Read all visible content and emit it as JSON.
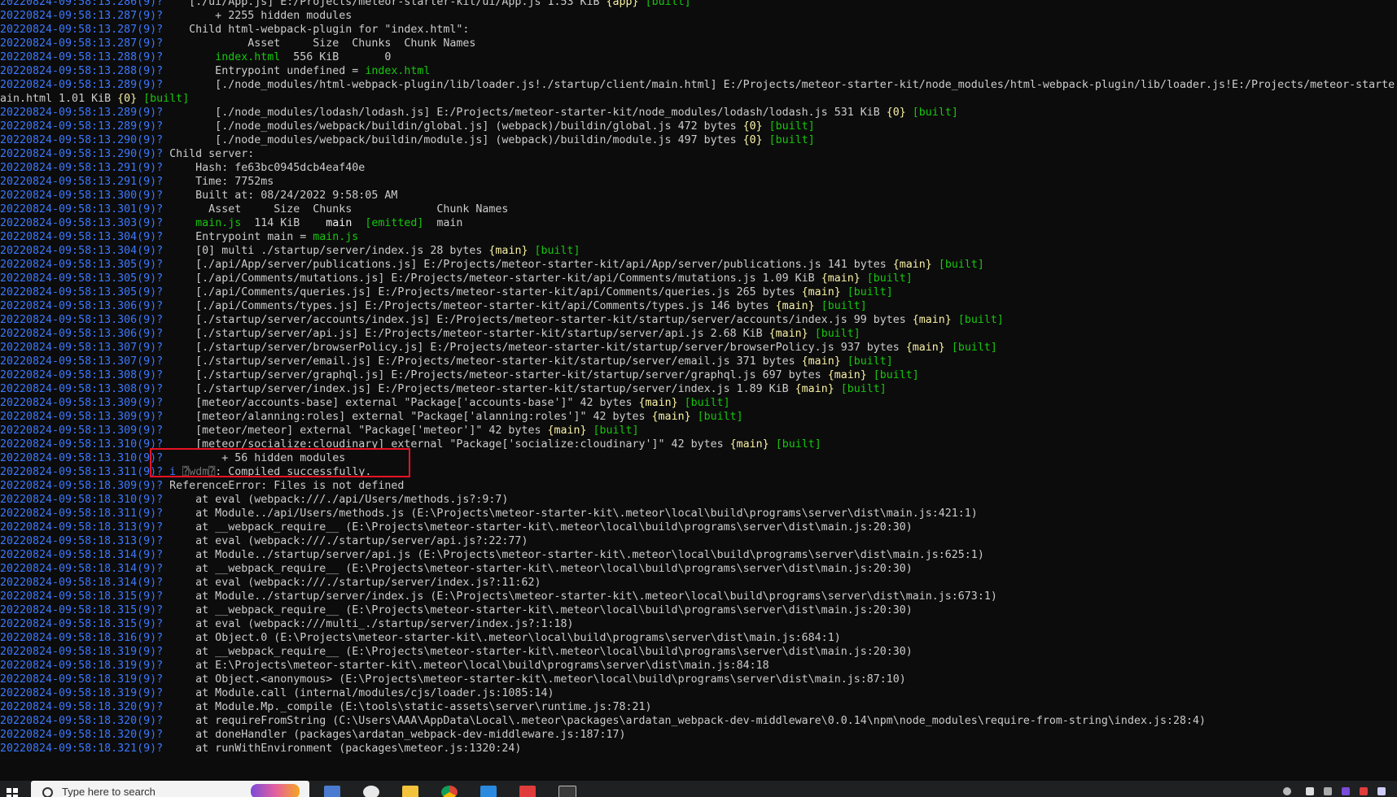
{
  "terminal": {
    "lines": [
      {
        "ts": "20220824-09:58:13.286(9)?",
        "segs": [
          {
            "t": "    [./ui/App.js] E:/Projects/meteor-starter-kit/ui/App.js 1.53 KiB "
          },
          {
            "t": "{app}",
            "c": "yellow"
          },
          {
            "t": " "
          },
          {
            "t": "[built]",
            "c": "green"
          }
        ]
      },
      {
        "ts": "20220824-09:58:13.287(9)?",
        "segs": [
          {
            "t": "        + 2255 hidden modules"
          }
        ]
      },
      {
        "ts": "20220824-09:58:13.287(9)?",
        "segs": [
          {
            "t": "    Child html-webpack-plugin for \"index.html\":"
          }
        ]
      },
      {
        "ts": "20220824-09:58:13.287(9)?",
        "segs": [
          {
            "t": "             Asset     Size  Chunks  Chunk Names"
          }
        ]
      },
      {
        "ts": "20220824-09:58:13.288(9)?",
        "segs": [
          {
            "t": "        "
          },
          {
            "t": "index.html",
            "c": "green"
          },
          {
            "t": "  556 KiB       0"
          }
        ]
      },
      {
        "ts": "20220824-09:58:13.288(9)?",
        "segs": [
          {
            "t": "        Entrypoint undefined = "
          },
          {
            "t": "index.html",
            "c": "green"
          }
        ]
      },
      {
        "ts": "20220824-09:58:13.289(9)?",
        "segs": [
          {
            "t": "        [./node_modules/html-webpack-plugin/lib/loader.js!./startup/client/main.html] E:/Projects/meteor-starter-kit/node_modules/html-webpack-plugin/lib/loader.js!E:/Projects/meteor-starte"
          }
        ]
      },
      {
        "ts": "",
        "segs": [
          {
            "t": "ain.html 1.01 KiB "
          },
          {
            "t": "{0}",
            "c": "yellow"
          },
          {
            "t": " "
          },
          {
            "t": "[built]",
            "c": "green"
          }
        ]
      },
      {
        "ts": "20220824-09:58:13.289(9)?",
        "segs": [
          {
            "t": "        [./node_modules/lodash/lodash.js] E:/Projects/meteor-starter-kit/node_modules/lodash/lodash.js 531 KiB "
          },
          {
            "t": "{0}",
            "c": "yellow"
          },
          {
            "t": " "
          },
          {
            "t": "[built]",
            "c": "green"
          }
        ]
      },
      {
        "ts": "20220824-09:58:13.289(9)?",
        "segs": [
          {
            "t": "        [./node_modules/webpack/buildin/global.js] (webpack)/buildin/global.js 472 bytes "
          },
          {
            "t": "{0}",
            "c": "yellow"
          },
          {
            "t": " "
          },
          {
            "t": "[built]",
            "c": "green"
          }
        ]
      },
      {
        "ts": "20220824-09:58:13.290(9)?",
        "segs": [
          {
            "t": "        [./node_modules/webpack/buildin/module.js] (webpack)/buildin/module.js 497 bytes "
          },
          {
            "t": "{0}",
            "c": "yellow"
          },
          {
            "t": " "
          },
          {
            "t": "[built]",
            "c": "green"
          }
        ]
      },
      {
        "ts": "20220824-09:58:13.290(9)?",
        "segs": [
          {
            "t": " Child server:"
          }
        ]
      },
      {
        "ts": "20220824-09:58:13.291(9)?",
        "segs": [
          {
            "t": "     Hash: fe63bc0945dcb4eaf40e"
          }
        ]
      },
      {
        "ts": "20220824-09:58:13.291(9)?",
        "segs": [
          {
            "t": "     Time: 7752ms"
          }
        ]
      },
      {
        "ts": "20220824-09:58:13.300(9)?",
        "segs": [
          {
            "t": "     Built at: 08/24/2022 9:58:05 AM"
          }
        ]
      },
      {
        "ts": "20220824-09:58:13.301(9)?",
        "segs": [
          {
            "t": "       Asset     Size  Chunks             Chunk Names"
          }
        ]
      },
      {
        "ts": "20220824-09:58:13.303(9)?",
        "segs": [
          {
            "t": "     "
          },
          {
            "t": "main.js",
            "c": "green"
          },
          {
            "t": "  114 KiB    "
          },
          {
            "t": "main",
            "c": "white"
          },
          {
            "t": "  "
          },
          {
            "t": "[emitted]",
            "c": "green"
          },
          {
            "t": "  main"
          }
        ]
      },
      {
        "ts": "20220824-09:58:13.304(9)?",
        "segs": [
          {
            "t": "     Entrypoint main = "
          },
          {
            "t": "main.js",
            "c": "green"
          }
        ]
      },
      {
        "ts": "20220824-09:58:13.304(9)?",
        "segs": [
          {
            "t": "     [0] multi ./startup/server/index.js 28 bytes "
          },
          {
            "t": "{main}",
            "c": "yellow"
          },
          {
            "t": " "
          },
          {
            "t": "[built]",
            "c": "green"
          }
        ]
      },
      {
        "ts": "20220824-09:58:13.305(9)?",
        "segs": [
          {
            "t": "     [./api/App/server/publications.js] E:/Projects/meteor-starter-kit/api/App/server/publications.js 141 bytes "
          },
          {
            "t": "{main}",
            "c": "yellow"
          },
          {
            "t": " "
          },
          {
            "t": "[built]",
            "c": "green"
          }
        ]
      },
      {
        "ts": "20220824-09:58:13.305(9)?",
        "segs": [
          {
            "t": "     [./api/Comments/mutations.js] E:/Projects/meteor-starter-kit/api/Comments/mutations.js 1.09 KiB "
          },
          {
            "t": "{main}",
            "c": "yellow"
          },
          {
            "t": " "
          },
          {
            "t": "[built]",
            "c": "green"
          }
        ]
      },
      {
        "ts": "20220824-09:58:13.305(9)?",
        "segs": [
          {
            "t": "     [./api/Comments/queries.js] E:/Projects/meteor-starter-kit/api/Comments/queries.js 265 bytes "
          },
          {
            "t": "{main}",
            "c": "yellow"
          },
          {
            "t": " "
          },
          {
            "t": "[built]",
            "c": "green"
          }
        ]
      },
      {
        "ts": "20220824-09:58:13.306(9)?",
        "segs": [
          {
            "t": "     [./api/Comments/types.js] E:/Projects/meteor-starter-kit/api/Comments/types.js 146 bytes "
          },
          {
            "t": "{main}",
            "c": "yellow"
          },
          {
            "t": " "
          },
          {
            "t": "[built]",
            "c": "green"
          }
        ]
      },
      {
        "ts": "20220824-09:58:13.306(9)?",
        "segs": [
          {
            "t": "     [./startup/server/accounts/index.js] E:/Projects/meteor-starter-kit/startup/server/accounts/index.js 99 bytes "
          },
          {
            "t": "{main}",
            "c": "yellow"
          },
          {
            "t": " "
          },
          {
            "t": "[built]",
            "c": "green"
          }
        ]
      },
      {
        "ts": "20220824-09:58:13.306(9)?",
        "segs": [
          {
            "t": "     [./startup/server/api.js] E:/Projects/meteor-starter-kit/startup/server/api.js 2.68 KiB "
          },
          {
            "t": "{main}",
            "c": "yellow"
          },
          {
            "t": " "
          },
          {
            "t": "[built]",
            "c": "green"
          }
        ]
      },
      {
        "ts": "20220824-09:58:13.307(9)?",
        "segs": [
          {
            "t": "     [./startup/server/browserPolicy.js] E:/Projects/meteor-starter-kit/startup/server/browserPolicy.js 937 bytes "
          },
          {
            "t": "{main}",
            "c": "yellow"
          },
          {
            "t": " "
          },
          {
            "t": "[built]",
            "c": "green"
          }
        ]
      },
      {
        "ts": "20220824-09:58:13.307(9)?",
        "segs": [
          {
            "t": "     [./startup/server/email.js] E:/Projects/meteor-starter-kit/startup/server/email.js 371 bytes "
          },
          {
            "t": "{main}",
            "c": "yellow"
          },
          {
            "t": " "
          },
          {
            "t": "[built]",
            "c": "green"
          }
        ]
      },
      {
        "ts": "20220824-09:58:13.308(9)?",
        "segs": [
          {
            "t": "     [./startup/server/graphql.js] E:/Projects/meteor-starter-kit/startup/server/graphql.js 697 bytes "
          },
          {
            "t": "{main}",
            "c": "yellow"
          },
          {
            "t": " "
          },
          {
            "t": "[built]",
            "c": "green"
          }
        ]
      },
      {
        "ts": "20220824-09:58:13.308(9)?",
        "segs": [
          {
            "t": "     [./startup/server/index.js] E:/Projects/meteor-starter-kit/startup/server/index.js 1.89 KiB "
          },
          {
            "t": "{main}",
            "c": "yellow"
          },
          {
            "t": " "
          },
          {
            "t": "[built]",
            "c": "green"
          }
        ]
      },
      {
        "ts": "20220824-09:58:13.309(9)?",
        "segs": [
          {
            "t": "     [meteor/accounts-base] external \"Package['accounts-base']\" 42 bytes "
          },
          {
            "t": "{main}",
            "c": "yellow"
          },
          {
            "t": " "
          },
          {
            "t": "[built]",
            "c": "green"
          }
        ]
      },
      {
        "ts": "20220824-09:58:13.309(9)?",
        "segs": [
          {
            "t": "     [meteor/alanning:roles] external \"Package['alanning:roles']\" 42 bytes "
          },
          {
            "t": "{main}",
            "c": "yellow"
          },
          {
            "t": " "
          },
          {
            "t": "[built]",
            "c": "green"
          }
        ]
      },
      {
        "ts": "20220824-09:58:13.309(9)?",
        "segs": [
          {
            "t": "     [meteor/meteor] external \"Package['meteor']\" 42 bytes "
          },
          {
            "t": "{main}",
            "c": "yellow"
          },
          {
            "t": " "
          },
          {
            "t": "[built]",
            "c": "green"
          }
        ]
      },
      {
        "ts": "20220824-09:58:13.310(9)?",
        "segs": [
          {
            "t": "     [meteor/socialize:cloudinary] external \"Package['socialize:cloudinary']\" 42 bytes "
          },
          {
            "t": "{main}",
            "c": "yellow"
          },
          {
            "t": " "
          },
          {
            "t": "[built]",
            "c": "green"
          }
        ]
      },
      {
        "ts": "20220824-09:58:13.310(9)?",
        "segs": [
          {
            "t": "         + 56 hidden modules"
          }
        ]
      },
      {
        "ts": "20220824-09:58:13.311(9)?",
        "segs": [
          {
            "t": " i ",
            "c": "info"
          },
          {
            "t": "⍰",
            "c": "dimbox"
          },
          {
            "t": "wdm",
            "c": "dimbox"
          },
          {
            "t": "⍰",
            "c": "dimbox"
          },
          {
            "t": ": Compiled successfully."
          }
        ]
      },
      {
        "ts": "20220824-09:58:18.309(9)?",
        "segs": [
          {
            "t": " ReferenceError: Files is not defined"
          }
        ]
      },
      {
        "ts": "20220824-09:58:18.310(9)?",
        "segs": [
          {
            "t": "     at eval (webpack:///./api/Users/methods.js?:9:7)"
          }
        ]
      },
      {
        "ts": "20220824-09:58:18.311(9)?",
        "segs": [
          {
            "t": "     at Module../api/Users/methods.js (E:\\Projects\\meteor-starter-kit\\.meteor\\local\\build\\programs\\server\\dist\\main.js:421:1)"
          }
        ]
      },
      {
        "ts": "20220824-09:58:18.313(9)?",
        "segs": [
          {
            "t": "     at __webpack_require__ (E:\\Projects\\meteor-starter-kit\\.meteor\\local\\build\\programs\\server\\dist\\main.js:20:30)"
          }
        ]
      },
      {
        "ts": "20220824-09:58:18.313(9)?",
        "segs": [
          {
            "t": "     at eval (webpack:///./startup/server/api.js?:22:77)"
          }
        ]
      },
      {
        "ts": "20220824-09:58:18.314(9)?",
        "segs": [
          {
            "t": "     at Module../startup/server/api.js (E:\\Projects\\meteor-starter-kit\\.meteor\\local\\build\\programs\\server\\dist\\main.js:625:1)"
          }
        ]
      },
      {
        "ts": "20220824-09:58:18.314(9)?",
        "segs": [
          {
            "t": "     at __webpack_require__ (E:\\Projects\\meteor-starter-kit\\.meteor\\local\\build\\programs\\server\\dist\\main.js:20:30)"
          }
        ]
      },
      {
        "ts": "20220824-09:58:18.314(9)?",
        "segs": [
          {
            "t": "     at eval (webpack:///./startup/server/index.js?:11:62)"
          }
        ]
      },
      {
        "ts": "20220824-09:58:18.315(9)?",
        "segs": [
          {
            "t": "     at Module../startup/server/index.js (E:\\Projects\\meteor-starter-kit\\.meteor\\local\\build\\programs\\server\\dist\\main.js:673:1)"
          }
        ]
      },
      {
        "ts": "20220824-09:58:18.315(9)?",
        "segs": [
          {
            "t": "     at __webpack_require__ (E:\\Projects\\meteor-starter-kit\\.meteor\\local\\build\\programs\\server\\dist\\main.js:20:30)"
          }
        ]
      },
      {
        "ts": "20220824-09:58:18.315(9)?",
        "segs": [
          {
            "t": "     at eval (webpack:///multi_./startup/server/index.js?:1:18)"
          }
        ]
      },
      {
        "ts": "20220824-09:58:18.316(9)?",
        "segs": [
          {
            "t": "     at Object.0 (E:\\Projects\\meteor-starter-kit\\.meteor\\local\\build\\programs\\server\\dist\\main.js:684:1)"
          }
        ]
      },
      {
        "ts": "20220824-09:58:18.319(9)?",
        "segs": [
          {
            "t": "     at __webpack_require__ (E:\\Projects\\meteor-starter-kit\\.meteor\\local\\build\\programs\\server\\dist\\main.js:20:30)"
          }
        ]
      },
      {
        "ts": "20220824-09:58:18.319(9)?",
        "segs": [
          {
            "t": "     at E:\\Projects\\meteor-starter-kit\\.meteor\\local\\build\\programs\\server\\dist\\main.js:84:18"
          }
        ]
      },
      {
        "ts": "20220824-09:58:18.319(9)?",
        "segs": [
          {
            "t": "     at Object.<anonymous> (E:\\Projects\\meteor-starter-kit\\.meteor\\local\\build\\programs\\server\\dist\\main.js:87:10)"
          }
        ]
      },
      {
        "ts": "20220824-09:58:18.319(9)?",
        "segs": [
          {
            "t": "     at Module.call (internal/modules/cjs/loader.js:1085:14)"
          }
        ]
      },
      {
        "ts": "20220824-09:58:18.320(9)?",
        "segs": [
          {
            "t": "     at Module.Mp._compile (E:\\tools\\static-assets\\server\\runtime.js:78:21)"
          }
        ]
      },
      {
        "ts": "20220824-09:58:18.320(9)?",
        "segs": [
          {
            "t": "     at requireFromString (C:\\Users\\AAA\\AppData\\Local\\.meteor\\packages\\ardatan_webpack-dev-middleware\\0.0.14\\npm\\node_modules\\require-from-string\\index.js:28:4)"
          }
        ]
      },
      {
        "ts": "20220824-09:58:18.320(9)?",
        "segs": [
          {
            "t": "     at doneHandler (packages\\ardatan_webpack-dev-middleware.js:187:17)"
          }
        ]
      },
      {
        "ts": "20220824-09:58:18.321(9)?",
        "segs": [
          {
            "t": "     at runWithEnvironment (packages\\meteor.js:1320:24)"
          }
        ]
      }
    ]
  },
  "taskbar": {
    "search_placeholder": "Type here to search"
  },
  "colors": {
    "background": "#0c0c0c",
    "text": "#cccccc",
    "timestamp": "#3b78ff",
    "green": "#16c60c",
    "yellow": "#f9f1a5",
    "highlight_box": "#e81123"
  }
}
